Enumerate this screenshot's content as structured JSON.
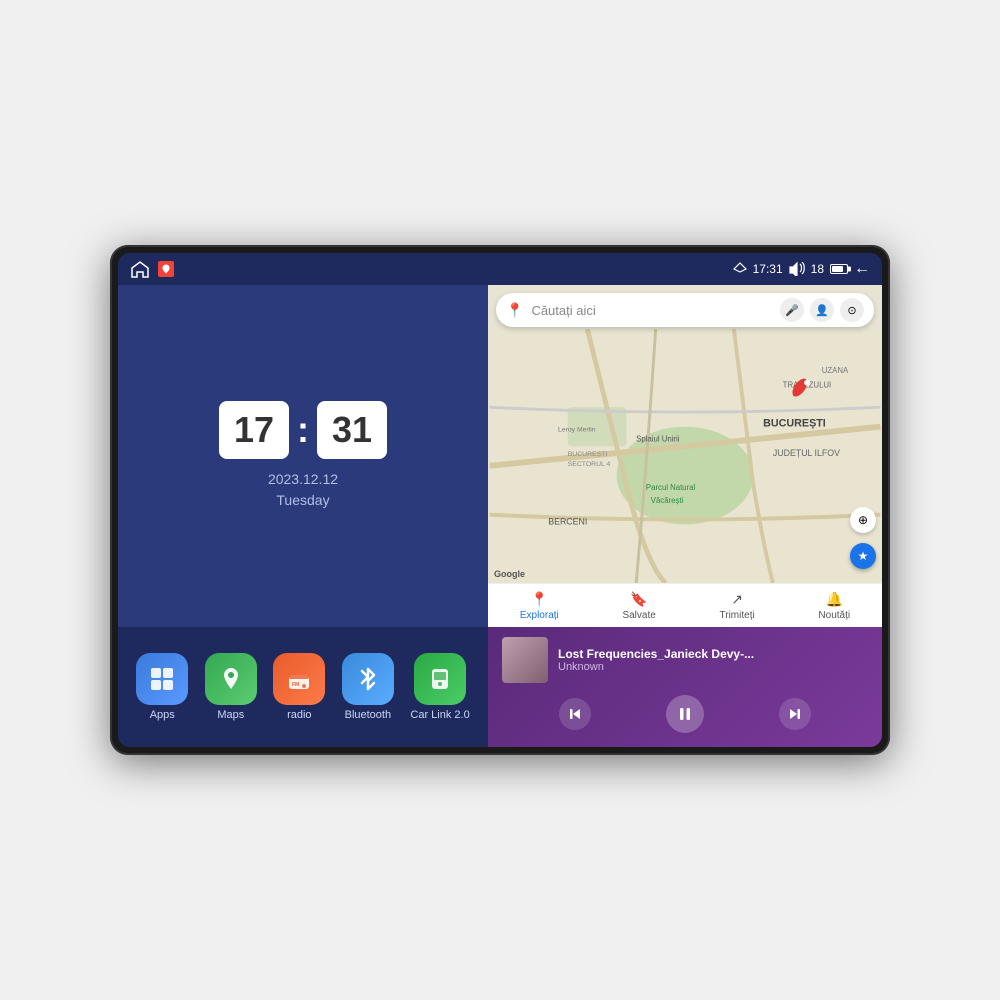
{
  "device": {
    "screen": {
      "status_bar": {
        "time": "17:31",
        "signal_strength": "18",
        "back_label": "←"
      }
    },
    "clock_widget": {
      "hour": "17",
      "minute": "31",
      "date": "2023.12.12",
      "day": "Tuesday"
    },
    "map_widget": {
      "search_placeholder": "Căutați aici",
      "nav_items": [
        {
          "label": "Explorați",
          "active": true
        },
        {
          "label": "Salvate",
          "active": false
        },
        {
          "label": "Trimiteți",
          "active": false
        },
        {
          "label": "Noutăți",
          "active": false
        }
      ],
      "map_labels": [
        "BUCUREȘTI",
        "JUDEȚUL ILFOV",
        "BERCENI",
        "Parcul Natural Văcărești",
        "Leroy Merlin",
        "BUCUREȘTI SECTORUL 4",
        "TRAPEZULUI",
        "Splaiul Unirii",
        "UZANA"
      ],
      "google_logo": "Google"
    },
    "apps": [
      {
        "id": "apps",
        "label": "Apps",
        "icon": "⊞"
      },
      {
        "id": "maps",
        "label": "Maps",
        "icon": "📍"
      },
      {
        "id": "radio",
        "label": "radio",
        "icon": "📻"
      },
      {
        "id": "bluetooth",
        "label": "Bluetooth",
        "icon": "🔷"
      },
      {
        "id": "carlink",
        "label": "Car Link 2.0",
        "icon": "📱"
      }
    ],
    "music_player": {
      "title": "Lost Frequencies_Janieck Devy-...",
      "artist": "Unknown",
      "controls": {
        "prev": "⏮",
        "play": "⏸",
        "next": "⏭"
      }
    }
  }
}
